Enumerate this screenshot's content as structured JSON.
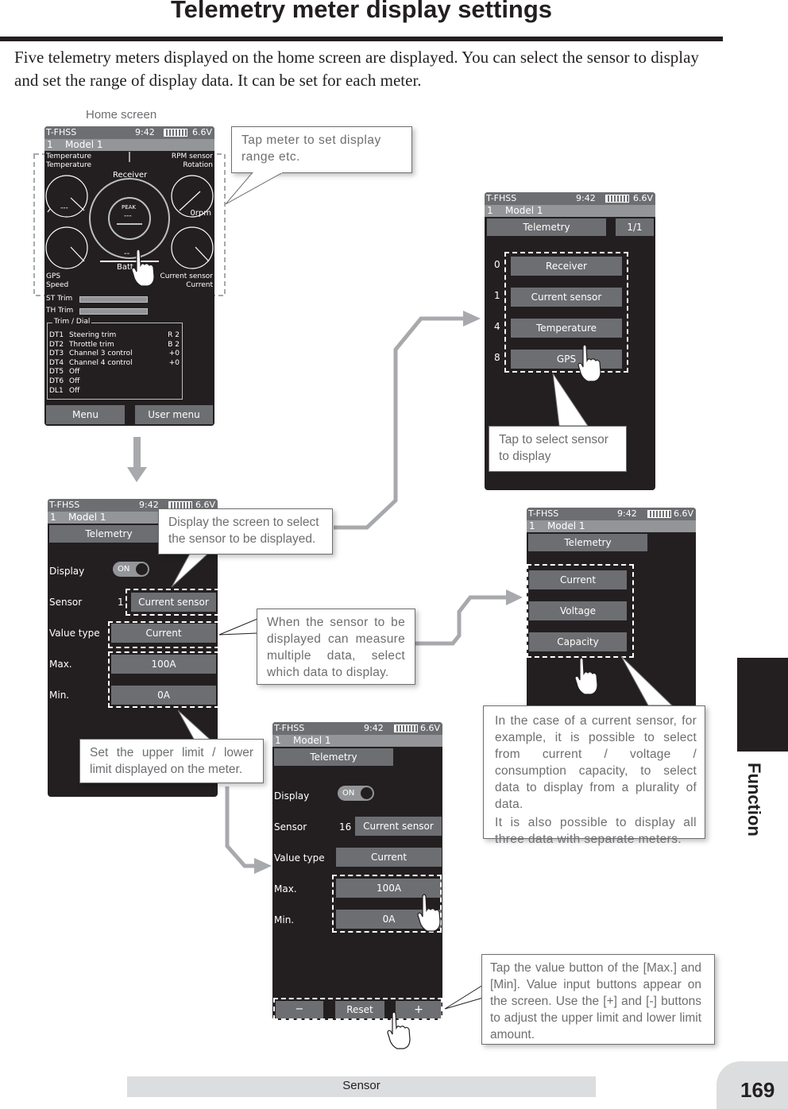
{
  "page": {
    "title": "Telemetry meter display settings",
    "intro": "Five telemetry meters displayed on the home screen are displayed. You can select the sensor to display and set the range of display data. It can be set for each meter.",
    "home_screen_label": "Home screen",
    "section_tab": "Function",
    "footer_section": "Sensor",
    "page_number": "169"
  },
  "status_bar": {
    "system": "T-FHSS",
    "time": "9:42",
    "voltage": "6.6V",
    "model_number": "1",
    "model_name": "Model 1"
  },
  "home_screen": {
    "meters": {
      "top_left_sensor": "Temperature",
      "top_left_type": "Temperature",
      "top_left_value": "---",
      "top_right_sensor": "RPM sensor",
      "top_right_type": "Rotation",
      "top_right_value": "0rpm",
      "center_sensor": "Receiver",
      "center_peak_label": "PEAK",
      "center_peak_value": "---",
      "center_value": "--",
      "center_type": "Batt",
      "bottom_left_sensor": "GPS",
      "bottom_left_type": "Speed",
      "bottom_right_sensor": "Current sensor",
      "bottom_right_type": "Current"
    },
    "trims": [
      {
        "label": "ST Trim"
      },
      {
        "label": "TH Trim"
      }
    ],
    "trim_dial_title": "Trim / Dial",
    "trim_dial_rows": [
      {
        "id": "DT1",
        "name": "Steering trim",
        "value": "R 2"
      },
      {
        "id": "DT2",
        "name": "Throttle trim",
        "value": "B 2"
      },
      {
        "id": "DT3",
        "name": "Channel 3 control",
        "value": "+0"
      },
      {
        "id": "DT4",
        "name": "Channel 4 control",
        "value": "+0"
      },
      {
        "id": "DT5",
        "name": "Off",
        "value": ""
      },
      {
        "id": "DT6",
        "name": "Off",
        "value": ""
      },
      {
        "id": "DL1",
        "name": "Off",
        "value": ""
      }
    ],
    "menu_button": "Menu",
    "user_menu_button": "User menu"
  },
  "sensor_list_screen": {
    "tab": "Telemetry",
    "page_indicator": "1/1",
    "sensors": [
      {
        "slot": "0",
        "name": "Receiver"
      },
      {
        "slot": "1",
        "name": "Current sensor"
      },
      {
        "slot": "4",
        "name": "Temperature"
      },
      {
        "slot": "8",
        "name": "GPS"
      }
    ]
  },
  "meter_settings_screen": {
    "tab": "Telemetry",
    "display_label": "Display",
    "display_toggle": "ON",
    "sensor_label": "Sensor",
    "sensor_slot": "1",
    "sensor_value": "Current sensor",
    "value_type_label": "Value type",
    "value_type": "Current",
    "max_label": "Max.",
    "max_value": "100A",
    "min_label": "Min.",
    "min_value": "0A"
  },
  "value_type_screen": {
    "tab": "Telemetry",
    "options": [
      "Current",
      "Voltage",
      "Capacity"
    ]
  },
  "value_input_screen": {
    "tab": "Telemetry",
    "display_label": "Display",
    "display_toggle": "ON",
    "sensor_label": "Sensor",
    "sensor_slot": "16",
    "sensor_value": "Current sensor",
    "value_type_label": "Value type",
    "value_type": "Current",
    "max_label": "Max.",
    "max_value": "100A",
    "min_label": "Min.",
    "min_value": "0A",
    "minus_button": "−",
    "reset_button": "Reset",
    "plus_button": "+"
  },
  "callouts": {
    "tap_meter": "Tap meter to set display range etc.",
    "tap_select_sensor": "Tap to select sensor to display",
    "display_screen": "Display the screen to select the sensor to be displayed.",
    "multiple_data": "When the sensor to be displayed can measure multiple data, select which data to display.",
    "limits": "Set the upper limit / lower limit displayed on the meter.",
    "current_sensor_example_1": "In the case of a current sensor, for example, it is possible to select from current / voltage / consumption capacity, to select data to display from a plurality of data.",
    "current_sensor_example_2": "It is also possible to display all three data with separate meters.",
    "value_buttons": "Tap the value button of the [Max.] and [Min]. Value input buttons appear on the screen. Use the [+] and [-] buttons to adjust the upper limit and lower limit amount."
  },
  "colors": {
    "screen_bg": "#231f20",
    "button_grey": "#6d6e71",
    "model_bar_grey": "#939598",
    "arrow_grey": "#a7a9ac",
    "callout_text": "#6d6e71",
    "footer_bar": "#dcdddf"
  }
}
